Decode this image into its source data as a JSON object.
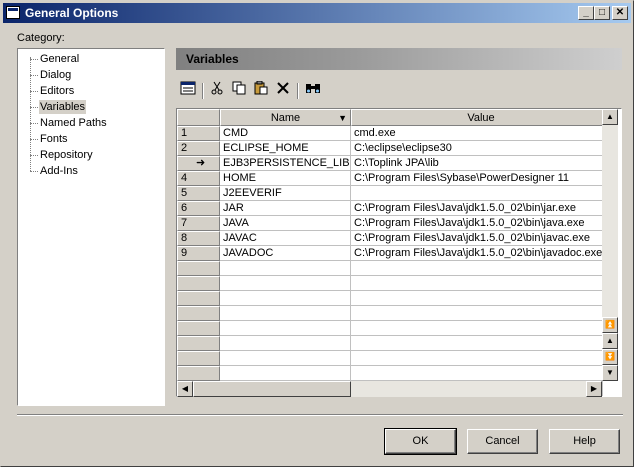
{
  "window": {
    "title": "General Options"
  },
  "caption_buttons": {
    "minimize": "_",
    "maximize": "□",
    "close": "✕"
  },
  "category": {
    "label": "Category:",
    "items": [
      {
        "label": "General"
      },
      {
        "label": "Dialog"
      },
      {
        "label": "Editors"
      },
      {
        "label": "Variables",
        "selected": true
      },
      {
        "label": "Named Paths"
      },
      {
        "label": "Fonts"
      },
      {
        "label": "Repository"
      },
      {
        "label": "Add-Ins"
      }
    ]
  },
  "section": {
    "title": "Variables"
  },
  "toolbar": {
    "icons": [
      "properties-icon",
      "cut-icon",
      "copy-icon",
      "paste-icon",
      "delete-icon",
      "find-icon"
    ]
  },
  "grid": {
    "columns": [
      "Name",
      "Value"
    ],
    "rows": [
      {
        "num": "1",
        "name": "CMD",
        "value": "cmd.exe"
      },
      {
        "num": "2",
        "name": "ECLIPSE_HOME",
        "value": "C:\\eclipse\\eclipse30"
      },
      {
        "num": "➜",
        "name": "EJB3PERSISTENCE_LIB",
        "value": "C:\\Toplink JPA\\lib"
      },
      {
        "num": "4",
        "name": "HOME",
        "value": "C:\\Program Files\\Sybase\\PowerDesigner 11"
      },
      {
        "num": "5",
        "name": "J2EEVERIF",
        "value": ""
      },
      {
        "num": "6",
        "name": "JAR",
        "value": "C:\\Program Files\\Java\\jdk1.5.0_02\\bin\\jar.exe"
      },
      {
        "num": "7",
        "name": "JAVA",
        "value": "C:\\Program Files\\Java\\jdk1.5.0_02\\bin\\java.exe"
      },
      {
        "num": "8",
        "name": "JAVAC",
        "value": "C:\\Program Files\\Java\\jdk1.5.0_02\\bin\\javac.exe"
      },
      {
        "num": "9",
        "name": "JAVADOC",
        "value": "C:\\Program Files\\Java\\jdk1.5.0_02\\bin\\javadoc.exe"
      }
    ]
  },
  "buttons": {
    "ok": "OK",
    "cancel": "Cancel",
    "help": "Help"
  }
}
